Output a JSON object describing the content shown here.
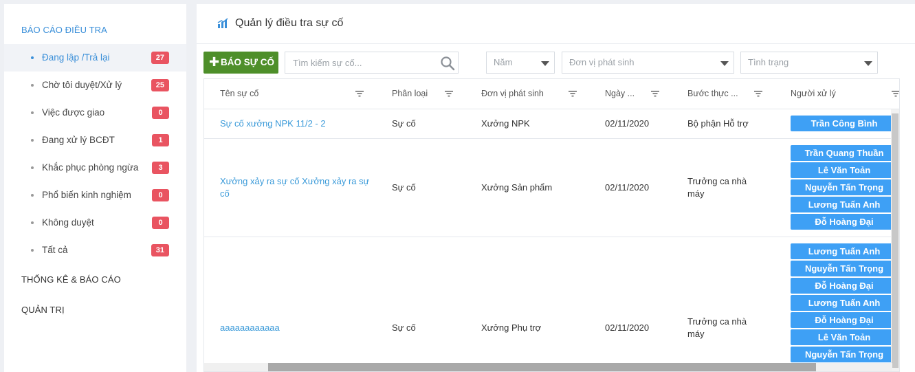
{
  "sidebar": {
    "section_report": "BÁO CÁO ĐIỀU TRA",
    "items": [
      {
        "label": "Đang lập /Trả lại",
        "count": "27"
      },
      {
        "label": "Chờ tôi duyệt/Xử lý",
        "count": "25"
      },
      {
        "label": "Việc được giao",
        "count": "0"
      },
      {
        "label": "Đang xử lý BCĐT",
        "count": "1"
      },
      {
        "label": "Khắc phục phòng ngừa",
        "count": "3"
      },
      {
        "label": "Phổ biến kinh nghiệm",
        "count": "0"
      },
      {
        "label": "Không duyệt",
        "count": "0"
      },
      {
        "label": "Tất cả",
        "count": "31"
      }
    ],
    "section_stats": "THỐNG KÊ & BÁO CÁO",
    "section_admin": "QUẢN TRỊ"
  },
  "header": {
    "title": "Quản lý điều tra sự cố",
    "icon": "bar-chart-icon"
  },
  "toolbar": {
    "report_button": "BÁO SỰ CỐ",
    "search_placeholder": "Tìm kiếm sự cố...",
    "year_select": "Năm",
    "unit_select": "Đơn vị phát sinh",
    "status_select": "Tình trạng"
  },
  "table": {
    "columns": [
      "Tên sự cố",
      "Phân loại",
      "Đơn vị phát sinh",
      "Ngày ...",
      "Bước thực ...",
      "Người xử lý"
    ],
    "rows": [
      {
        "name": "Sự cố xưởng NPK 11/2 - 2",
        "type": "Sự cố",
        "unit": "Xưởng NPK",
        "date": "02/11/2020",
        "step": "Bộ phận Hỗ trợ",
        "handlers": [
          "Trần Công Bình"
        ]
      },
      {
        "name": "Xưởng xảy ra sự cố Xưởng xảy ra sự cố",
        "type": "Sự cố",
        "unit": "Xưởng Sản phẩm",
        "date": "02/11/2020",
        "step": "Trưởng ca nhà máy",
        "handlers": [
          "Trần Quang Thuần",
          "Lê Văn Toản",
          "Nguyễn Tấn Trọng",
          "Lương Tuấn Anh",
          "Đỗ Hoàng Đại"
        ]
      },
      {
        "name": "aaaaaaaaaaaa",
        "type": "Sự cố",
        "unit": "Xưởng Phụ trợ",
        "date": "02/11/2020",
        "step": "Trưởng ca nhà máy",
        "handlers": [
          "Lương Tuấn Anh",
          "Nguyễn Tấn Trọng",
          "Đỗ Hoàng Đại",
          "Lương Tuấn Anh",
          "Đỗ Hoàng Đại",
          "Lê Văn Toản",
          "Nguyễn Tấn Trọng"
        ]
      }
    ]
  },
  "colors": {
    "accent": "#3a8fd9",
    "badge": "#e95461",
    "report_button": "#4e8f2a",
    "handler_chip": "#3ea0f5"
  }
}
